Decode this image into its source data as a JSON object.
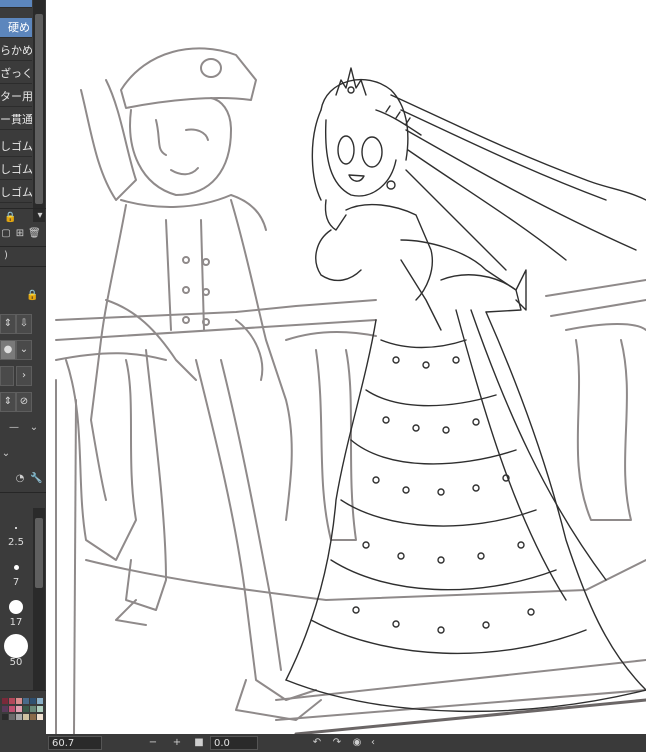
{
  "subtools": [
    {
      "label": "硬め",
      "active": true
    },
    {
      "label": "らかめ",
      "active": false
    },
    {
      "label": "ざっくり",
      "active": false
    },
    {
      "label": "ター用",
      "active": false
    },
    {
      "label": "ー貫通",
      "active": false
    },
    {
      "label": "しゴム",
      "active": false
    },
    {
      "label": "しゴム",
      "active": false
    },
    {
      "label": "しゴム",
      "active": false
    }
  ],
  "brush_sizes": [
    "2.5",
    "7",
    "17",
    "50"
  ],
  "status": {
    "zoom": "60.7",
    "angle": "0.0"
  },
  "colors": {
    "panel": "#3b3b3b",
    "accent": "#5c86bd",
    "rough_sketch": "#8f8a8a",
    "line_art": "#2f2f2f"
  }
}
